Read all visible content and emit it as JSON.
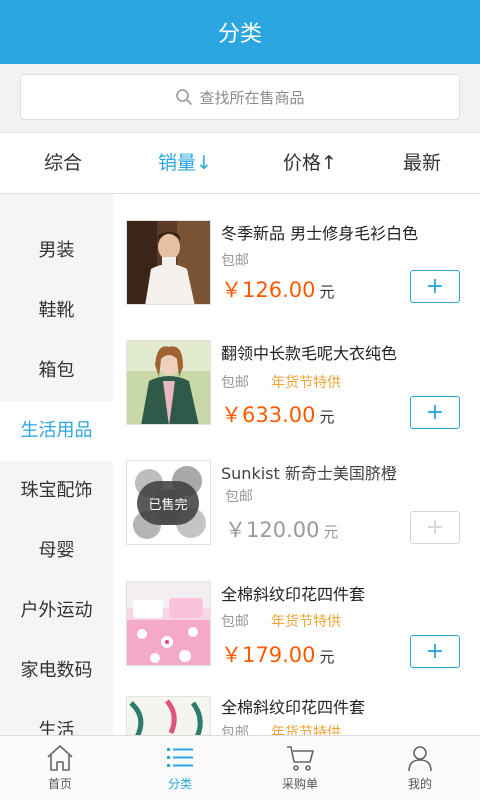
{
  "header": {
    "title": "分类"
  },
  "search": {
    "placeholder": "查找所在售商品"
  },
  "sort": [
    {
      "label": "综合"
    },
    {
      "label": "销量↓"
    },
    {
      "label": "价格↑"
    },
    {
      "label": "最新"
    }
  ],
  "sidebar": {
    "items": [
      {
        "label": "男装"
      },
      {
        "label": "鞋靴"
      },
      {
        "label": "箱包"
      },
      {
        "label": "生活用品"
      },
      {
        "label": "珠宝配饰"
      },
      {
        "label": "母婴"
      },
      {
        "label": "户外运动"
      },
      {
        "label": "家电数码"
      },
      {
        "label": "生活"
      }
    ],
    "active_index": 3
  },
  "products": [
    {
      "title": "冬季新品 男士修身毛衫白色",
      "shipping": "包邮",
      "promo": "",
      "price": "￥126.00",
      "unit": "元",
      "sold_out": false,
      "add": "+"
    },
    {
      "title": "翻领中长款毛呢大衣纯色",
      "shipping": "包邮",
      "promo": "年货节特供",
      "price": "￥633.00",
      "unit": "元",
      "sold_out": false,
      "add": "+"
    },
    {
      "title": "Sunkist 新奇士美国脐橙",
      "shipping": "包邮",
      "promo": "",
      "price": "￥120.00",
      "unit": "元",
      "sold_out": true,
      "sold_label": "已售完",
      "add": "+"
    },
    {
      "title": "全棉斜纹印花四件套",
      "shipping": "包邮",
      "promo": "年货节特供",
      "price": "￥179.00",
      "unit": "元",
      "sold_out": false,
      "add": "+"
    },
    {
      "title": "全棉斜纹印花四件套",
      "shipping": "包邮",
      "promo": "年货节特供",
      "price": "",
      "unit": "",
      "sold_out": false,
      "add": ""
    }
  ],
  "tabbar": [
    {
      "label": "首页",
      "icon": "home-icon"
    },
    {
      "label": "分类",
      "icon": "category-icon"
    },
    {
      "label": "采购单",
      "icon": "cart-icon"
    },
    {
      "label": "我的",
      "icon": "user-icon"
    }
  ],
  "colors": {
    "primary": "#2ba6e1",
    "price": "#ff5a00",
    "promo": "#f2a33a"
  }
}
